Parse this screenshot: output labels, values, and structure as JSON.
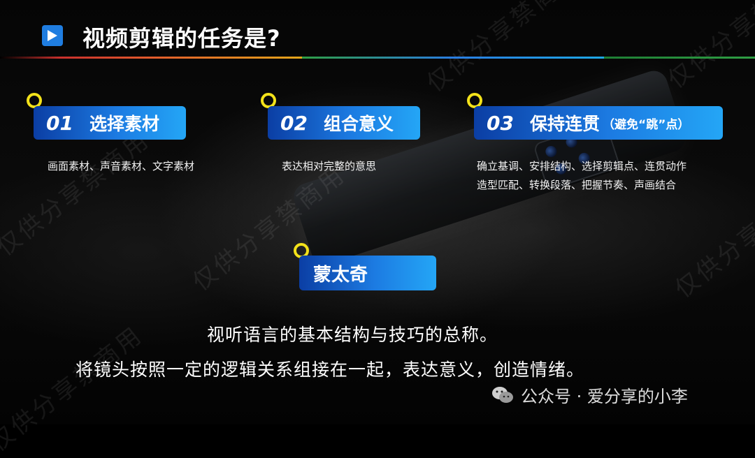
{
  "title": "视频剪辑的任务是?",
  "rule_colors": [
    "#c9302c",
    "#e3a51a",
    "#2f9e44",
    "#2a7de1",
    "#d33",
    "#1ea7e5"
  ],
  "accent": "#1f7de0",
  "ring_color": "#f3e21a",
  "cards": [
    {
      "num": "01",
      "label": "选择素材",
      "note": "",
      "desc": [
        "画面素材、声音素材、文字素材"
      ]
    },
    {
      "num": "02",
      "label": "组合意义",
      "note": "",
      "desc": [
        "表达相对完整的意思"
      ]
    },
    {
      "num": "03",
      "label": "保持连贯",
      "note": "（避免“跳”点）",
      "desc": [
        "确立基调、安排结构、选择剪辑点、连贯动作",
        "造型匹配、转换段落、把握节奏、声画结合"
      ]
    }
  ],
  "montage": {
    "label": "蒙太奇"
  },
  "definition": [
    "视听语言的基本结构与技巧的总称。",
    "将镜头按照一定的逻辑关系组接在一起，表达意义，创造情绪。"
  ],
  "footer": {
    "text": "公众号 · 爱分享的小李",
    "icon": "wechat-icon"
  },
  "watermark": "仅供分享禁商用"
}
